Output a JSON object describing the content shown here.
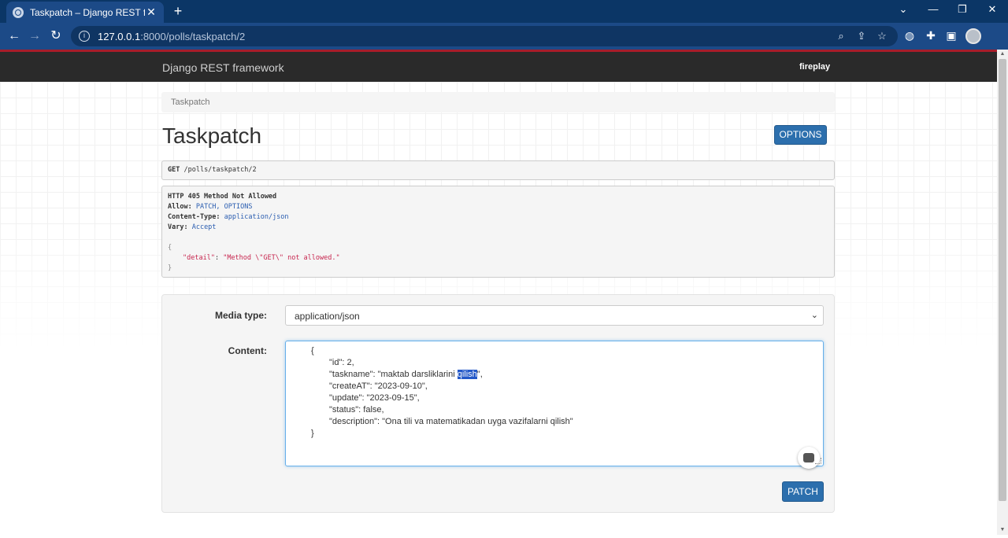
{
  "browser": {
    "tab_title": "Taskpatch – Django REST framew",
    "tab_close": "✕",
    "new_tab": "+",
    "url_host": "127.0.0.1",
    "url_path": ":8000/polls/taskpatch/2",
    "win_min": "—",
    "win_max": "❐",
    "win_close": "✕",
    "win_down": "⌄"
  },
  "navbar": {
    "brand": "Django REST framework",
    "user": "fireplay"
  },
  "breadcrumb": "Taskpatch",
  "page_title": "Taskpatch",
  "options_label": "OPTIONS",
  "request": {
    "method": "GET",
    "path": " /polls/taskpatch/2"
  },
  "response": {
    "status": "HTTP 405 Method Not Allowed",
    "allow_key": "Allow:",
    "allow_val": " PATCH, OPTIONS",
    "ctype_key": "Content-Type:",
    "ctype_val": " application/json",
    "vary_key": "Vary:",
    "vary_val": " Accept",
    "open": "{",
    "detail_key": "\"detail\"",
    "detail_sep": ": ",
    "detail_val": "\"Method \\\"GET\\\" not allowed.\"",
    "close": "}"
  },
  "form": {
    "media_label": "Media type:",
    "media_value": "application/json",
    "content_label": "Content:",
    "content_lines": [
      "{",
      "\"id\": 2,",
      "\"taskname\": \"maktab darsliklarini ",
      "\"createAT\": \"2023-09-10\",",
      "\"update\": \"2023-09-15\",",
      "\"status\": false,",
      "\"description\": \"Ona tili va matematikadan uyga vazifalarni qilish\"",
      "}"
    ],
    "highlight": "qilish",
    "after_highlight": "\",",
    "patch_label": "PATCH"
  }
}
